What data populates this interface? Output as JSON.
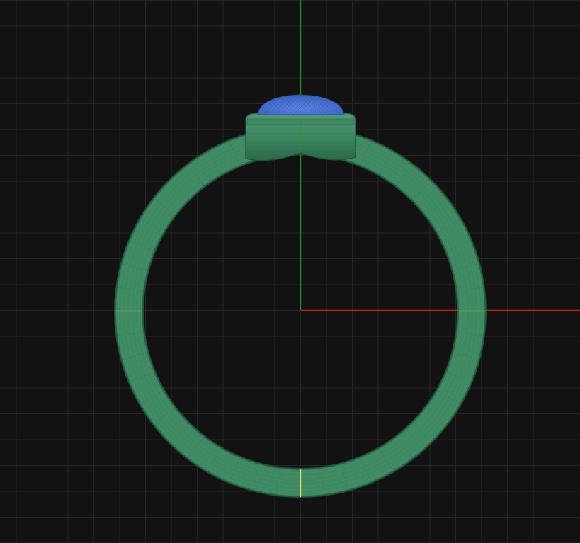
{
  "viewport": {
    "view": "front",
    "background_color": "#121212",
    "grid": true,
    "grid_color": "#262626",
    "axes": {
      "x_axis_color": "#c81e1e",
      "y_axis_color": "#12a012"
    }
  },
  "model": {
    "ring_shank": {
      "name": "ring-shank",
      "color": "#3f8a62"
    },
    "bezel_setting": {
      "name": "bezel-setting",
      "color": "#2f7a54"
    },
    "gemstone": {
      "name": "cabochon-gemstone",
      "color": "#4a72d4"
    },
    "marker_color": "#e8e05a"
  }
}
